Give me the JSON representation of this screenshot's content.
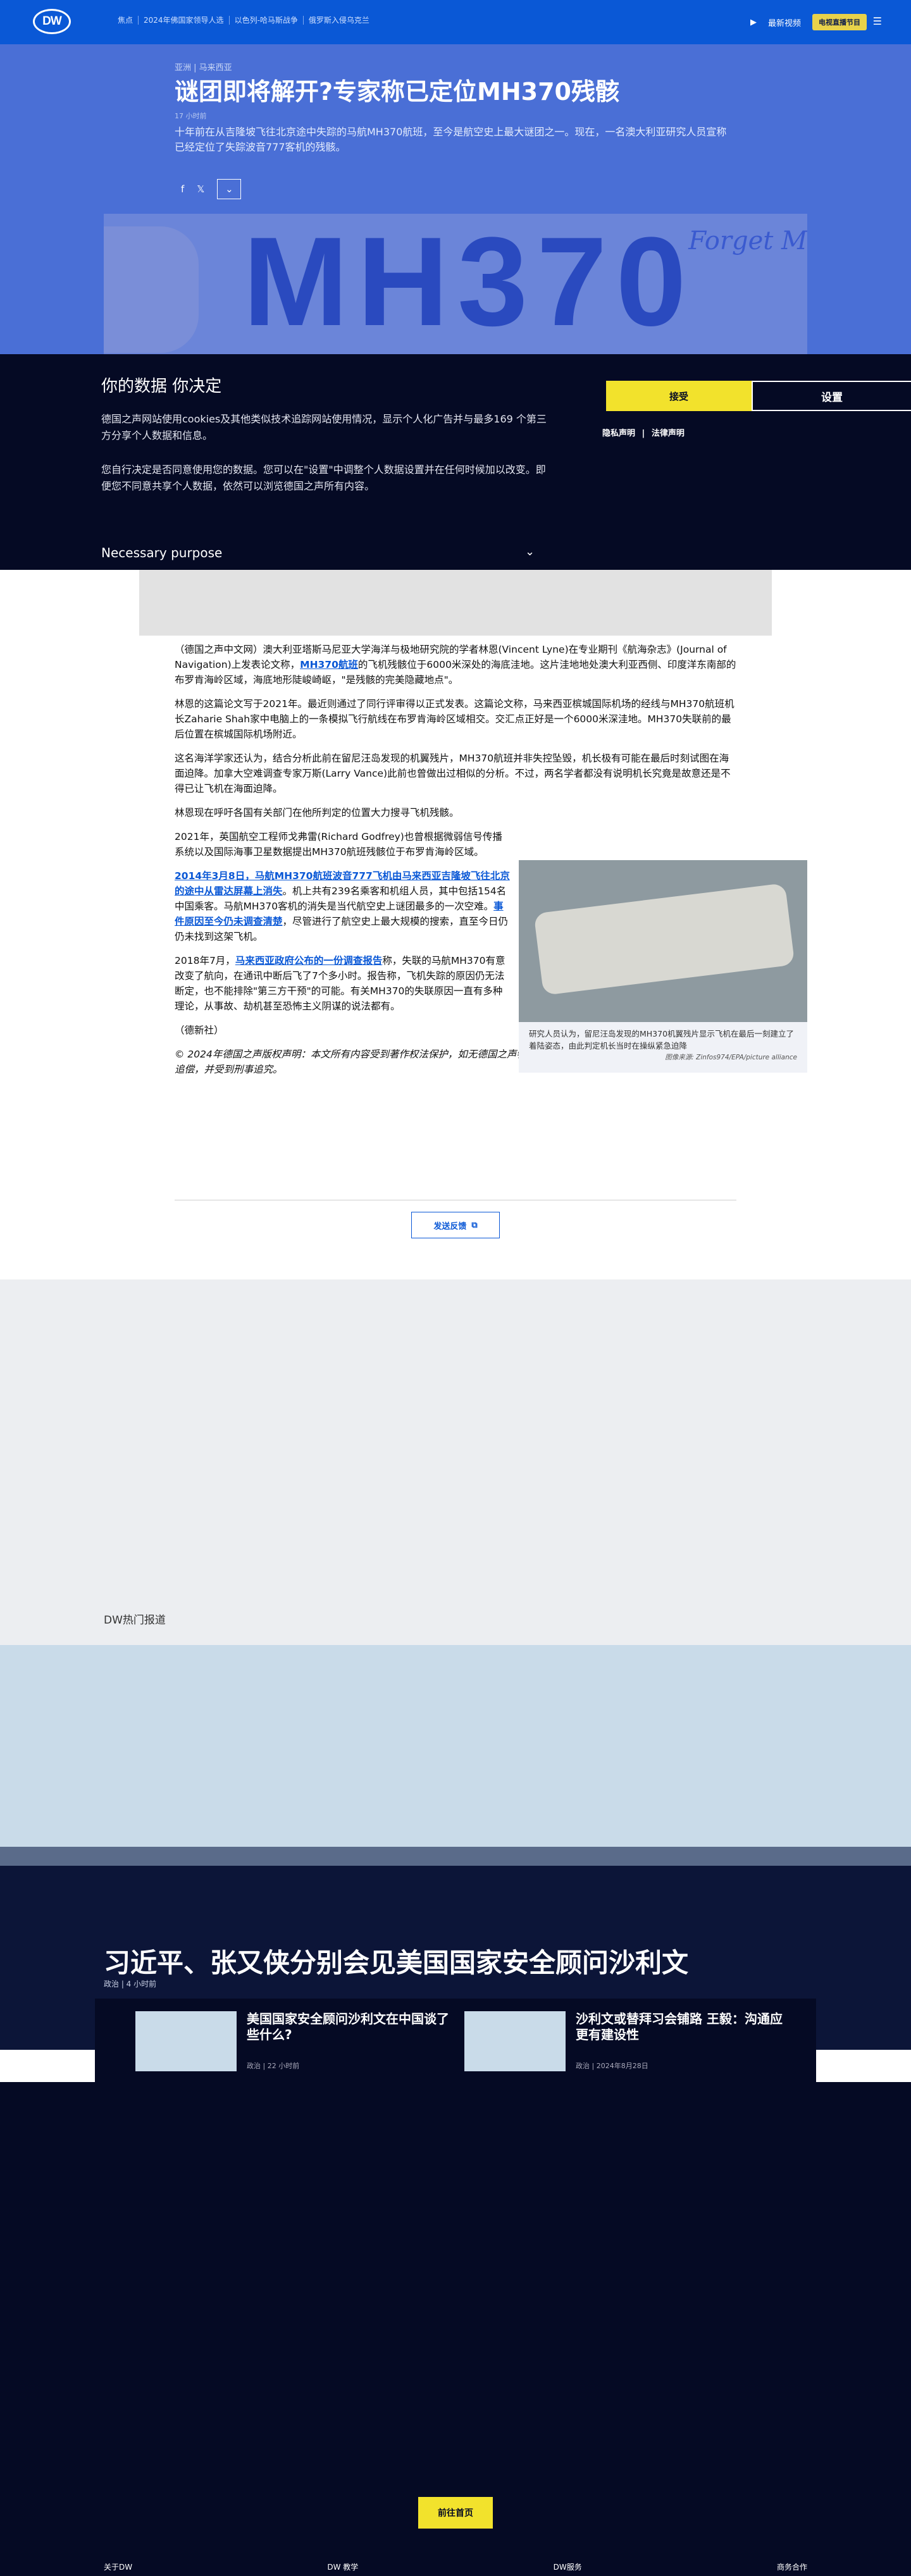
{
  "header": {
    "logo": "DW",
    "nav": [
      "焦点",
      "2024年佛国家领导人选",
      "以色列-哈马斯战争",
      "俄罗斯入侵乌克兰"
    ],
    "latest": "最新视频",
    "live": "电视直播节目",
    "menu_icon": "hamburger-icon"
  },
  "article_header": {
    "breadcrumb": "亚洲 | 马来西亚",
    "title": "谜团即将解开?专家称已定位MH370残骸",
    "time": "17 小时前",
    "lead": "十年前在从吉隆坡飞往北京途中失踪的马航MH370航班，至今是航空史上最大谜团之一。现在，一名澳大利亚研究人员宣称已经定位了失踪波音777客机的残骸。"
  },
  "share": {
    "facebook": "f",
    "x": "𝕏",
    "more": "⌄"
  },
  "hero_image": {
    "mh": "MH370",
    "forget": "Forget M"
  },
  "consent": {
    "title": "你的数据 你决定",
    "p1": "德国之声网站使用cookies及其他类似技术追踪网站使用情况，显示个人化广告并与最多169 个第三方分享个人数据和信息。",
    "p2": "您自行决定是否同意使用您的数据。您可以在\"设置\"中调整个人数据设置并在任何时候加以改变。即便您不同意共享个人数据，依然可以浏览德国之声所有内容。",
    "accept": "接受",
    "settings": "设置",
    "privacy": "隐私声明",
    "sep": "|",
    "legal": "法律声明",
    "necessary": "Necessary purpose",
    "chevron": "⌄"
  },
  "body": {
    "p1_a": "（德国之声中文网）澳大利亚塔斯马尼亚大学海洋与极地研究院的学者林恩(Vincent Lyne)在专业期刊《航海杂志》(Journal of Navigation)上发表论文称，",
    "p1_link": "MH370航班",
    "p1_b": "的飞机残骸位于6000米深处的海底洼地。这片洼地地处澳大利亚西侧、印度洋东南部的布罗肯海岭区域，海底地形陡峻崎岖，\"是残骸的完美隐藏地点\"。",
    "p2": "林恩的这篇论文写于2021年。最近则通过了同行评审得以正式发表。这篇论文称，马来西亚槟城国际机场的经线与MH370航班机长Zaharie Shah家中电脑上的一条模拟飞行航线在布罗肯海岭区域相交。交汇点正好是一个6000米深洼地。MH370失联前的最后位置在槟城国际机场附近。",
    "p3": "这名海洋学家还认为，结合分析此前在留尼汪岛发现的机翼残片，MH370航班并非失控坠毁，机长极有可能在最后时刻试图在海面迫降。加拿大空难调查专家万斯(Larry Vance)此前也曾做出过相似的分析。不过，两名学者都没有说明机长究竟是故意还是不得已让飞机在海面迫降。",
    "p4": "林恩现在呼吁各国有关部门在他所判定的位置大力搜寻飞机残骸。",
    "p5": "2021年，英国航空工程师戈弗雷(Richard Godfrey)也曾根据微弱信号传播系统以及国际海事卫星数据提出MH370航班残骸位于布罗肯海岭区域。",
    "p6_link": "2014年3月8日，马航MH370航班波音777飞机由马来西亚吉隆坡飞往北京的途中从雷达屏幕上消失",
    "p6_a": "。机上共有239名乘客和机组人员，其中包括154名中国乘客。马航MH370客机的消失是当代航空史上谜团最多的一次空难。",
    "p6_link2": "事件原因至今仍未调查清楚",
    "p6_b": "，尽管进行了航空史上最大规模的搜索，直至今日仍仍未找到这架飞机。",
    "p7_a": "2018年7月，",
    "p7_link": "马来西亚政府公布的一份调查报告",
    "p7_b": "称，失联的马航MH370有意改变了航向，在通讯中断后飞了7个多小时。报告称，飞机失踪的原因仍无法断定，也不能排除\"第三方干预\"的可能。有关MH370的失联原因一直有多种理论，从事故、劫机甚至恐怖主义阴谋的说法都有。",
    "p8": "（德新社）",
    "copyright": "© 2024年德国之声版权声明：本文所有内容受到著作权法保护，如无德国之声特别授权，不得擅自使用。任何不当行为都将导致追偿，并受到刑事追究。",
    "figure_caption": "研究人员认为，留尼汪岛发现的MH370机翼残片显示飞机在最后一刻建立了着陆姿态，由此判定机长当时在操纵紧急迫降",
    "figure_credit": "图像来源: Zinfos974/EPA/picture alliance",
    "feedback": "发送反馈"
  },
  "hot": {
    "label": "DW热门报道",
    "title": "习近平、张又侠分别会见美国国家安全顾问沙利文",
    "meta": "政治 | 4 小时前",
    "cards": [
      {
        "title": "美国国家安全顾问沙利文在中国谈了些什么?",
        "meta": "政治 | 22 小时前"
      },
      {
        "title": "沙利文或替拜习会铺路 王毅：沟通应更有建设性",
        "meta": "政治 | 2024年8月28日"
      }
    ],
    "home": "前往首页"
  },
  "footer": {
    "links": [
      "关于DW",
      "DW 教学",
      "DW服务",
      "商务合作"
    ]
  }
}
